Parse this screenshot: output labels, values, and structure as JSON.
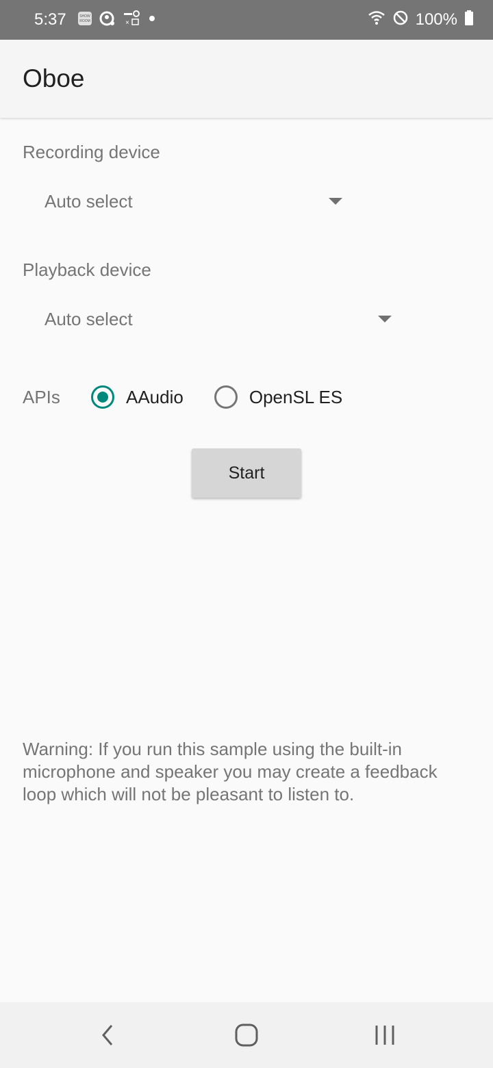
{
  "status_bar": {
    "time": "5:37",
    "battery_text": "100%",
    "icons": [
      "showroom-icon",
      "assistant-icon",
      "keys-icon",
      "dot-icon",
      "wifi-icon",
      "do-not-disturb-icon",
      "battery-icon"
    ]
  },
  "app_bar": {
    "title": "Oboe"
  },
  "recording": {
    "label": "Recording device",
    "selected": "Auto select"
  },
  "playback": {
    "label": "Playback device",
    "selected": "Auto select"
  },
  "apis": {
    "label": "APIs",
    "options": [
      {
        "label": "AAudio",
        "checked": true
      },
      {
        "label": "OpenSL ES",
        "checked": false
      }
    ]
  },
  "start_button": {
    "label": "Start"
  },
  "warning": {
    "text": "Warning: If you run this sample using the built-in microphone and speaker you may create a feedback loop which will not be pleasant to listen to."
  },
  "nav_bar": {
    "icons": [
      "back-icon",
      "home-icon",
      "recents-icon"
    ]
  },
  "colors": {
    "accent": "#00897b",
    "status_bar": "#757575",
    "button": "#d6d6d6"
  }
}
